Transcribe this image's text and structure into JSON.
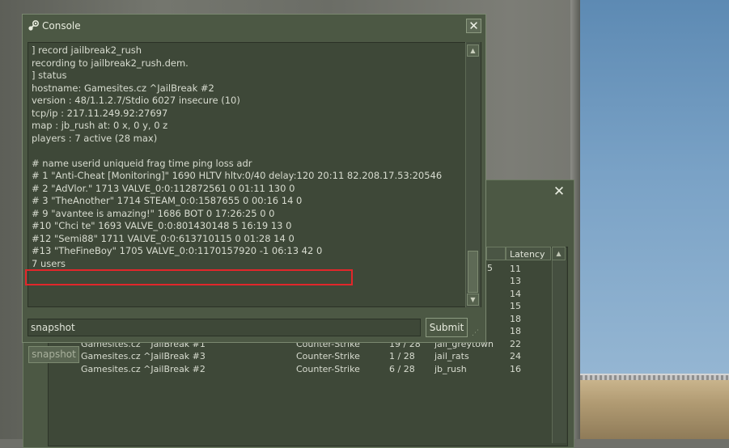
{
  "console": {
    "title": "Console",
    "close_label": "✕",
    "lines": [
      "] record jailbreak2_rush",
      "recording to jailbreak2_rush.dem.",
      "] status",
      "hostname:  Gamesites.cz ^JailBreak #2",
      "version : 48/1.1.2.7/Stdio 6027 insecure  (10)",
      "tcp/ip  :  217.11.249.92:27697",
      "map     :  jb_rush at: 0 x, 0 y, 0 z",
      "players :  7 active (28 max)",
      "",
      "#      name userid uniqueid frag time ping loss adr",
      "# 1 \"Anti-Cheat [Monitoring]\" 1690 HLTV hltv:0/40 delay:120 20:11 82.208.17.53:20546",
      "# 2 \"AdVlor.\" 1713 VALVE_0:0:112872561   0 01:11  130   0",
      "# 3 \"TheAnother\" 1714 STEAM_0:0:1587655   0 00:16   14   0",
      "# 9 \"avantee is amazing!\" 1686 BOT   0 17:26:25   0   0",
      "#10 \"Chci te\" 1693 VALVE_0:0:801430148   5 16:19   13   0",
      "#12 \"Semi88\" 1711 VALVE_0:0:613710115   0 01:28   14   0",
      "#13 \"TheFineBoy\" 1705 VALVE_0:0:1170157920  -1 06:13   42   0",
      "7 users"
    ],
    "input_value": "snapshot",
    "submit_label": "Submit"
  },
  "server_browser": {
    "close_label": "✕",
    "latency_header": "Latency",
    "partial_column_value": "5",
    "latency_values": [
      "11",
      "13",
      "14",
      "15",
      "18",
      "18"
    ],
    "rows": [
      {
        "name": "Gamesites.cz ^JailBreak #1",
        "game": "Counter-Strike",
        "players": "19 / 28",
        "map": "jail_greytown",
        "latency": "22"
      },
      {
        "name": "Gamesites.cz ^JailBreak #3",
        "game": "Counter-Strike",
        "players": "1 / 28",
        "map": "jail_rats",
        "latency": "24"
      },
      {
        "name": "Gamesites.cz ^JailBreak #2",
        "game": "Counter-Strike",
        "players": "6 / 28",
        "map": "jb_rush",
        "latency": "16"
      }
    ],
    "snapshot_button_label": "snapshot"
  },
  "icons": {
    "console_icon": "steam-icon",
    "close_icon": "close-icon",
    "scroll_up_icon": "scroll-up-icon",
    "scroll_down_icon": "scroll-down-icon"
  },
  "colors": {
    "panel": "#4c5844",
    "panel_dark": "#3e4838",
    "text": "#d8dcd0",
    "highlight": "#e2262a"
  }
}
